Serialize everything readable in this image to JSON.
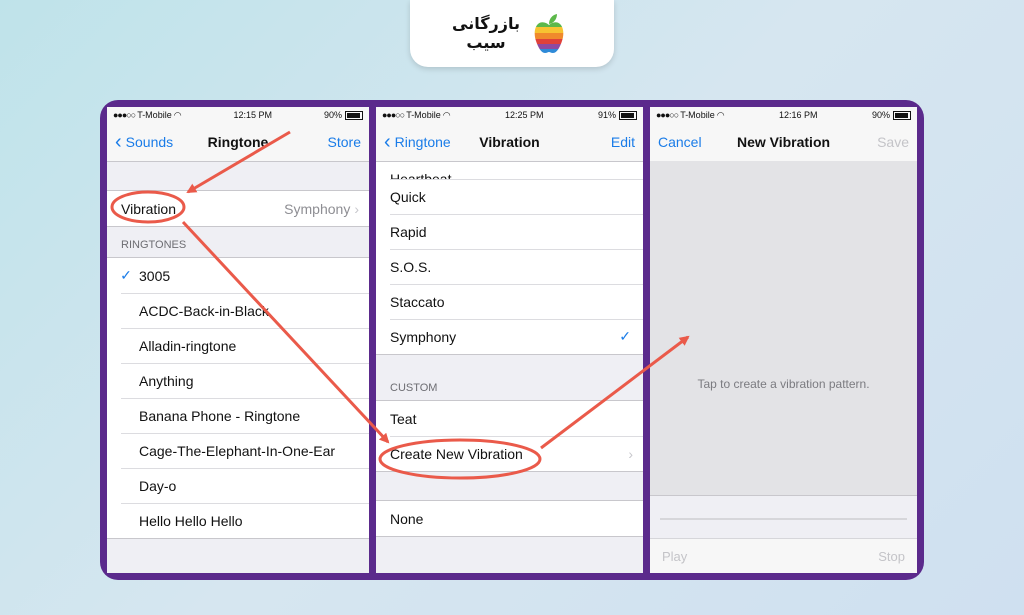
{
  "brand": {
    "line1": "بازرگانی",
    "line2": "سیب"
  },
  "screen1": {
    "status": {
      "carrier": "T-Mobile",
      "time": "12:15 PM",
      "battery": "90%"
    },
    "nav": {
      "back": "Sounds",
      "title": "Ringtone",
      "right": "Store"
    },
    "vibration": {
      "label": "Vibration",
      "value": "Symphony"
    },
    "section": "RINGTONES",
    "ringtones": [
      "3005",
      "ACDC-Back-in-Black",
      "Alladin-ringtone",
      "Anything",
      "Banana Phone - Ringtone",
      "Cage-The-Elephant-In-One-Ear",
      "Day-o",
      "Hello Hello Hello"
    ]
  },
  "screen2": {
    "status": {
      "carrier": "T-Mobile",
      "time": "12:25 PM",
      "battery": "91%"
    },
    "nav": {
      "back": "Ringtone",
      "title": "Vibration",
      "right": "Edit"
    },
    "partial": "Heartbeat",
    "items": [
      "Quick",
      "Rapid",
      "S.O.S.",
      "Staccato",
      "Symphony"
    ],
    "section": "CUSTOM",
    "custom": [
      "Teat",
      "Create New Vibration"
    ],
    "none": "None"
  },
  "screen3": {
    "status": {
      "carrier": "T-Mobile",
      "time": "12:16 PM",
      "battery": "90%"
    },
    "nav": {
      "left": "Cancel",
      "title": "New Vibration",
      "right": "Save"
    },
    "hint": "Tap to create a vibration pattern.",
    "play": "Play",
    "stop": "Stop"
  },
  "colors": {
    "accent": "#1a7ce8",
    "frame": "#5b2a8c",
    "annotation": "#ea5a4a"
  }
}
